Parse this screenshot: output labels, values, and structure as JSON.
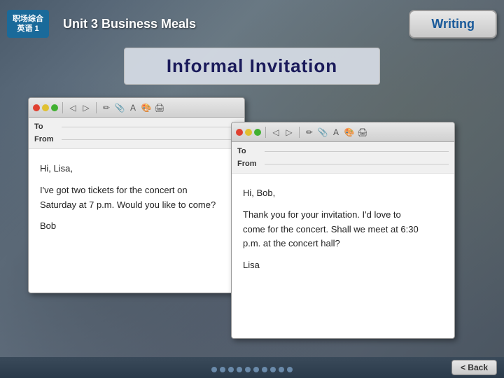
{
  "header": {
    "logo_line1": "职场综合",
    "logo_line2": "英语 1",
    "unit_title": "Unit 3 Business Meals",
    "writing_badge": "Writing"
  },
  "page_title": "Informal Invitation",
  "email_left": {
    "toolbar_dots": [
      "red",
      "yellow",
      "green"
    ],
    "fields": [
      {
        "label": "To"
      },
      {
        "label": "From"
      }
    ],
    "body_lines": [
      "Hi, Lisa,",
      "",
      "I've got two tickets for the concert on",
      "Saturday at 7 p.m. Would you like to come?",
      "",
      "Bob"
    ]
  },
  "email_right": {
    "toolbar_dots": [
      "red",
      "yellow",
      "green"
    ],
    "fields": [
      {
        "label": "To"
      },
      {
        "label": "From"
      }
    ],
    "body_lines": [
      "Hi, Bob,",
      "",
      "Thank you for your invitation. I'd love to",
      "come for the concert. Shall we meet at 6:30",
      "p.m. at the concert hall?",
      "",
      "Lisa"
    ]
  },
  "back_button": "< Back",
  "nav_dots": [
    1,
    2,
    3,
    4,
    5,
    6,
    7,
    8,
    9,
    10
  ]
}
